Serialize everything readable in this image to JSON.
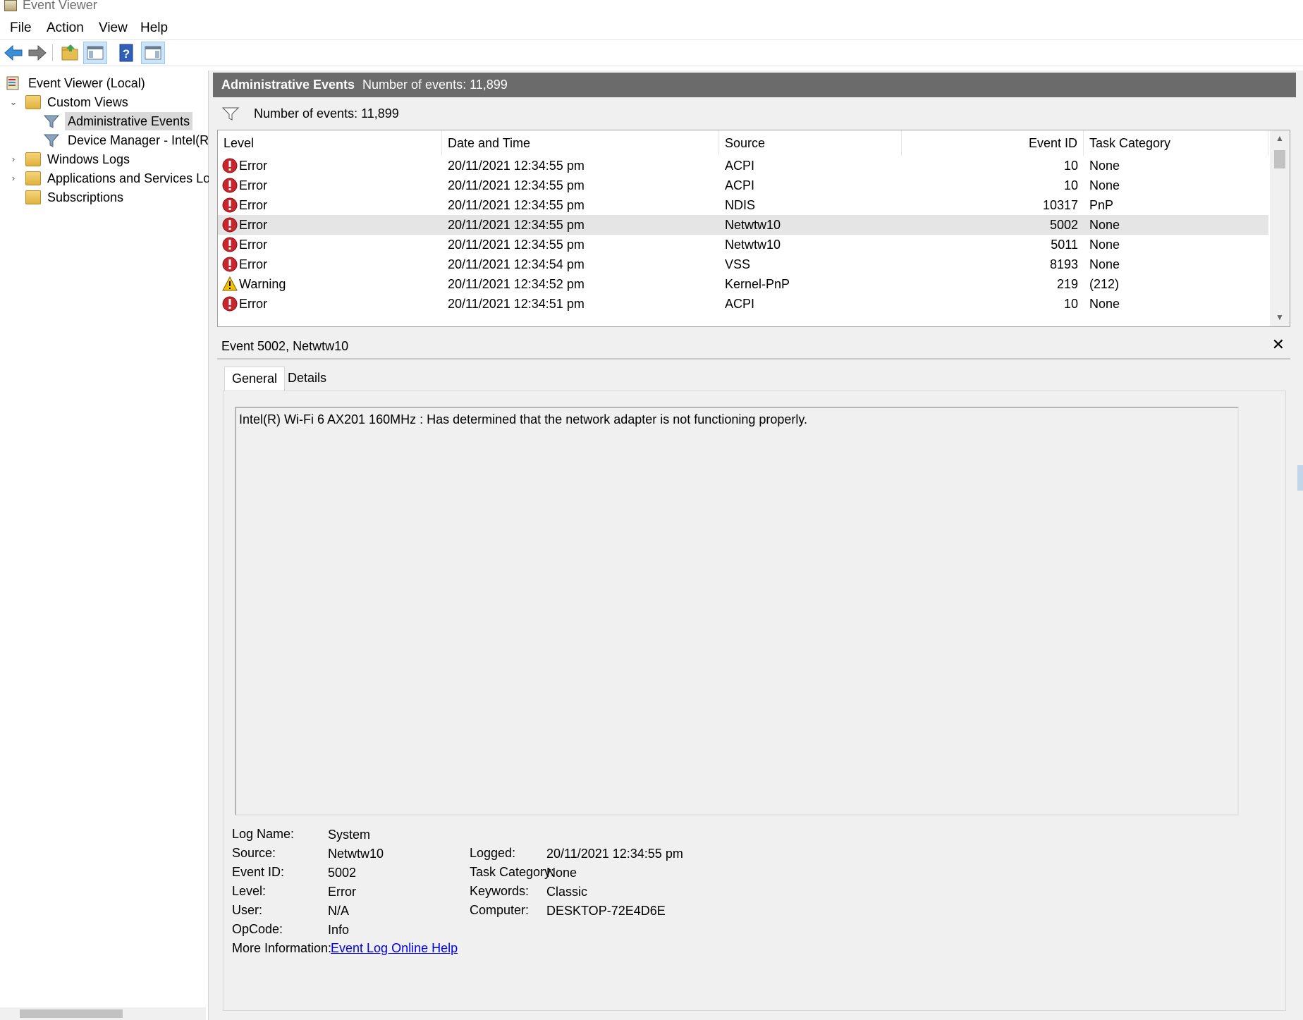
{
  "window": {
    "title": "Event Viewer"
  },
  "menu": [
    "File",
    "Action",
    "View",
    "Help"
  ],
  "toolbar": {
    "buttons": [
      "back-arrow-icon",
      "forward-arrow-icon",
      "open-folder-icon",
      "show-hide-console-tree-icon",
      "help-icon",
      "show-hide-action-pane-icon"
    ]
  },
  "tree": {
    "root": "Event Viewer (Local)",
    "custom_views": "Custom Views",
    "admin_events": "Administrative Events",
    "device_manager": "Device Manager - Intel(R)",
    "windows_logs": "Windows Logs",
    "apps_services": "Applications and Services Log",
    "subscriptions": "Subscriptions"
  },
  "main": {
    "header_title": "Administrative Events",
    "header_count": "Number of events: 11,899",
    "filter_count": "Number of events: 11,899",
    "columns": [
      "Level",
      "Date and Time",
      "Source",
      "Event ID",
      "Task Category"
    ],
    "rows": [
      {
        "level": "Error",
        "datetime": "20/11/2021 12:34:55 pm",
        "source": "ACPI",
        "event_id": "10",
        "task": "None"
      },
      {
        "level": "Error",
        "datetime": "20/11/2021 12:34:55 pm",
        "source": "ACPI",
        "event_id": "10",
        "task": "None"
      },
      {
        "level": "Error",
        "datetime": "20/11/2021 12:34:55 pm",
        "source": "NDIS",
        "event_id": "10317",
        "task": "PnP"
      },
      {
        "level": "Error",
        "datetime": "20/11/2021 12:34:55 pm",
        "source": "Netwtw10",
        "event_id": "5002",
        "task": "None"
      },
      {
        "level": "Error",
        "datetime": "20/11/2021 12:34:55 pm",
        "source": "Netwtw10",
        "event_id": "5011",
        "task": "None"
      },
      {
        "level": "Error",
        "datetime": "20/11/2021 12:34:54 pm",
        "source": "VSS",
        "event_id": "8193",
        "task": "None"
      },
      {
        "level": "Warning",
        "datetime": "20/11/2021 12:34:52 pm",
        "source": "Kernel-PnP",
        "event_id": "219",
        "task": "(212)"
      },
      {
        "level": "Error",
        "datetime": "20/11/2021 12:34:51 pm",
        "source": "ACPI",
        "event_id": "10",
        "task": "None"
      }
    ],
    "selected_row": 3
  },
  "detail": {
    "title": "Event 5002, Netwtw10",
    "close": "✕",
    "tabs": [
      "General",
      "Details"
    ],
    "message": "Intel(R) Wi-Fi 6 AX201 160MHz : Has determined that the network adapter is not functioning properly.",
    "labels": {
      "log_name": "Log Name:",
      "source": "Source:",
      "event_id": "Event ID:",
      "level": "Level:",
      "user": "User:",
      "opcode": "OpCode:",
      "more_info": "More Information:",
      "logged": "Logged:",
      "task_category": "Task Category:",
      "keywords": "Keywords:",
      "computer": "Computer:"
    },
    "values": {
      "log_name": "System",
      "source": "Netwtw10",
      "event_id": "5002",
      "level": "Error",
      "user": "N/A",
      "opcode": "Info",
      "more_info": "Event Log Online Help",
      "logged": "20/11/2021 12:34:55 pm",
      "task_category": "None",
      "keywords": "Classic",
      "computer": "DESKTOP-72E4D6E"
    }
  },
  "colors": {
    "header_bg": "#6b6b6b",
    "selected_row": "#e5e5e5",
    "error_red": "#c8262c",
    "warning_yellow": "#f2c200",
    "link": "#0000ee"
  }
}
